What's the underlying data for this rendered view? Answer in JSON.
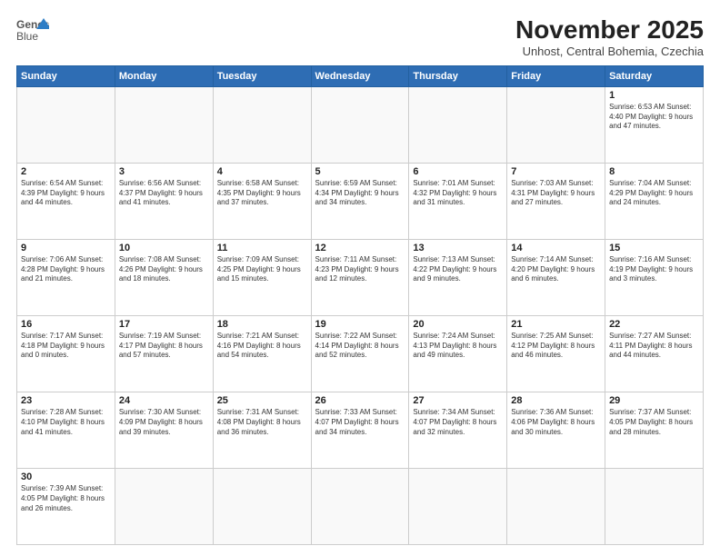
{
  "header": {
    "logo_line1": "General",
    "logo_line2": "Blue",
    "month_title": "November 2025",
    "subtitle": "Unhost, Central Bohemia, Czechia"
  },
  "days_of_week": [
    "Sunday",
    "Monday",
    "Tuesday",
    "Wednesday",
    "Thursday",
    "Friday",
    "Saturday"
  ],
  "weeks": [
    [
      {
        "day": "",
        "info": ""
      },
      {
        "day": "",
        "info": ""
      },
      {
        "day": "",
        "info": ""
      },
      {
        "day": "",
        "info": ""
      },
      {
        "day": "",
        "info": ""
      },
      {
        "day": "",
        "info": ""
      },
      {
        "day": "1",
        "info": "Sunrise: 6:53 AM\nSunset: 4:40 PM\nDaylight: 9 hours\nand 47 minutes."
      }
    ],
    [
      {
        "day": "2",
        "info": "Sunrise: 6:54 AM\nSunset: 4:39 PM\nDaylight: 9 hours\nand 44 minutes."
      },
      {
        "day": "3",
        "info": "Sunrise: 6:56 AM\nSunset: 4:37 PM\nDaylight: 9 hours\nand 41 minutes."
      },
      {
        "day": "4",
        "info": "Sunrise: 6:58 AM\nSunset: 4:35 PM\nDaylight: 9 hours\nand 37 minutes."
      },
      {
        "day": "5",
        "info": "Sunrise: 6:59 AM\nSunset: 4:34 PM\nDaylight: 9 hours\nand 34 minutes."
      },
      {
        "day": "6",
        "info": "Sunrise: 7:01 AM\nSunset: 4:32 PM\nDaylight: 9 hours\nand 31 minutes."
      },
      {
        "day": "7",
        "info": "Sunrise: 7:03 AM\nSunset: 4:31 PM\nDaylight: 9 hours\nand 27 minutes."
      },
      {
        "day": "8",
        "info": "Sunrise: 7:04 AM\nSunset: 4:29 PM\nDaylight: 9 hours\nand 24 minutes."
      }
    ],
    [
      {
        "day": "9",
        "info": "Sunrise: 7:06 AM\nSunset: 4:28 PM\nDaylight: 9 hours\nand 21 minutes."
      },
      {
        "day": "10",
        "info": "Sunrise: 7:08 AM\nSunset: 4:26 PM\nDaylight: 9 hours\nand 18 minutes."
      },
      {
        "day": "11",
        "info": "Sunrise: 7:09 AM\nSunset: 4:25 PM\nDaylight: 9 hours\nand 15 minutes."
      },
      {
        "day": "12",
        "info": "Sunrise: 7:11 AM\nSunset: 4:23 PM\nDaylight: 9 hours\nand 12 minutes."
      },
      {
        "day": "13",
        "info": "Sunrise: 7:13 AM\nSunset: 4:22 PM\nDaylight: 9 hours\nand 9 minutes."
      },
      {
        "day": "14",
        "info": "Sunrise: 7:14 AM\nSunset: 4:20 PM\nDaylight: 9 hours\nand 6 minutes."
      },
      {
        "day": "15",
        "info": "Sunrise: 7:16 AM\nSunset: 4:19 PM\nDaylight: 9 hours\nand 3 minutes."
      }
    ],
    [
      {
        "day": "16",
        "info": "Sunrise: 7:17 AM\nSunset: 4:18 PM\nDaylight: 9 hours\nand 0 minutes."
      },
      {
        "day": "17",
        "info": "Sunrise: 7:19 AM\nSunset: 4:17 PM\nDaylight: 8 hours\nand 57 minutes."
      },
      {
        "day": "18",
        "info": "Sunrise: 7:21 AM\nSunset: 4:16 PM\nDaylight: 8 hours\nand 54 minutes."
      },
      {
        "day": "19",
        "info": "Sunrise: 7:22 AM\nSunset: 4:14 PM\nDaylight: 8 hours\nand 52 minutes."
      },
      {
        "day": "20",
        "info": "Sunrise: 7:24 AM\nSunset: 4:13 PM\nDaylight: 8 hours\nand 49 minutes."
      },
      {
        "day": "21",
        "info": "Sunrise: 7:25 AM\nSunset: 4:12 PM\nDaylight: 8 hours\nand 46 minutes."
      },
      {
        "day": "22",
        "info": "Sunrise: 7:27 AM\nSunset: 4:11 PM\nDaylight: 8 hours\nand 44 minutes."
      }
    ],
    [
      {
        "day": "23",
        "info": "Sunrise: 7:28 AM\nSunset: 4:10 PM\nDaylight: 8 hours\nand 41 minutes."
      },
      {
        "day": "24",
        "info": "Sunrise: 7:30 AM\nSunset: 4:09 PM\nDaylight: 8 hours\nand 39 minutes."
      },
      {
        "day": "25",
        "info": "Sunrise: 7:31 AM\nSunset: 4:08 PM\nDaylight: 8 hours\nand 36 minutes."
      },
      {
        "day": "26",
        "info": "Sunrise: 7:33 AM\nSunset: 4:07 PM\nDaylight: 8 hours\nand 34 minutes."
      },
      {
        "day": "27",
        "info": "Sunrise: 7:34 AM\nSunset: 4:07 PM\nDaylight: 8 hours\nand 32 minutes."
      },
      {
        "day": "28",
        "info": "Sunrise: 7:36 AM\nSunset: 4:06 PM\nDaylight: 8 hours\nand 30 minutes."
      },
      {
        "day": "29",
        "info": "Sunrise: 7:37 AM\nSunset: 4:05 PM\nDaylight: 8 hours\nand 28 minutes."
      }
    ],
    [
      {
        "day": "30",
        "info": "Sunrise: 7:39 AM\nSunset: 4:05 PM\nDaylight: 8 hours\nand 26 minutes."
      },
      {
        "day": "",
        "info": ""
      },
      {
        "day": "",
        "info": ""
      },
      {
        "day": "",
        "info": ""
      },
      {
        "day": "",
        "info": ""
      },
      {
        "day": "",
        "info": ""
      },
      {
        "day": "",
        "info": ""
      }
    ]
  ]
}
